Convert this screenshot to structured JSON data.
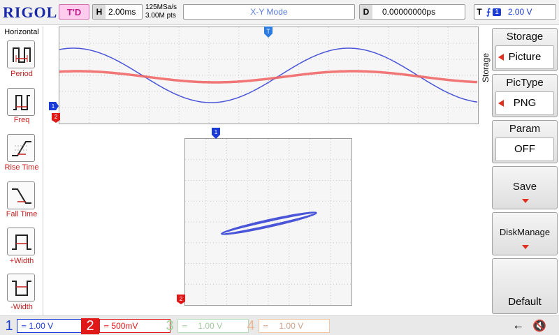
{
  "brand": "RIGOL",
  "topbar": {
    "run_state": "T'D",
    "timebase_tag": "H",
    "timebase": "2.00ms",
    "sample_rate": "125MSa/s",
    "memory_depth": "3.00M pts",
    "mode": "X-Y Mode",
    "delay_tag": "D",
    "delay": "0.00000000ps",
    "trigger_tag": "T",
    "trigger_source": "1",
    "trigger_level": "2.00 V"
  },
  "left_menu": {
    "title": "Horizontal",
    "items": [
      {
        "label": "Period",
        "icon": "period-icon"
      },
      {
        "label": "Freq",
        "icon": "frequency-icon"
      },
      {
        "label": "Rise Time",
        "icon": "rise-time-icon"
      },
      {
        "label": "Fall Time",
        "icon": "fall-time-icon"
      },
      {
        "label": "+Width",
        "icon": "positive-width-icon"
      },
      {
        "label": "-Width",
        "icon": "negative-width-icon"
      }
    ]
  },
  "right_menu": {
    "title": "Storage",
    "items": [
      {
        "label": "Storage",
        "value": "Picture"
      },
      {
        "label": "PicType",
        "value": "PNG"
      },
      {
        "label": "Param",
        "value": "OFF"
      },
      {
        "label": "Save"
      },
      {
        "label": "DiskManage"
      },
      {
        "label": "Default"
      }
    ]
  },
  "channels": [
    {
      "num": "1",
      "value": "1.00 V",
      "color": "#1a3bd6",
      "active": true
    },
    {
      "num": "2",
      "value": "500mV",
      "color": "#e01818",
      "active": true
    },
    {
      "num": "3",
      "value": "1.00 V",
      "color": "#9fd49f",
      "active": false
    },
    {
      "num": "4",
      "value": "1.00 V",
      "color": "#f0c8a8",
      "active": false
    }
  ],
  "markers": {
    "trigger_pos": "T",
    "ch1": "1",
    "ch2": "2"
  },
  "colors": {
    "ch1": "#4a55d8",
    "ch2": "#f06060",
    "grid": "#c8c8c8",
    "brand": "#1a2aa8"
  }
}
